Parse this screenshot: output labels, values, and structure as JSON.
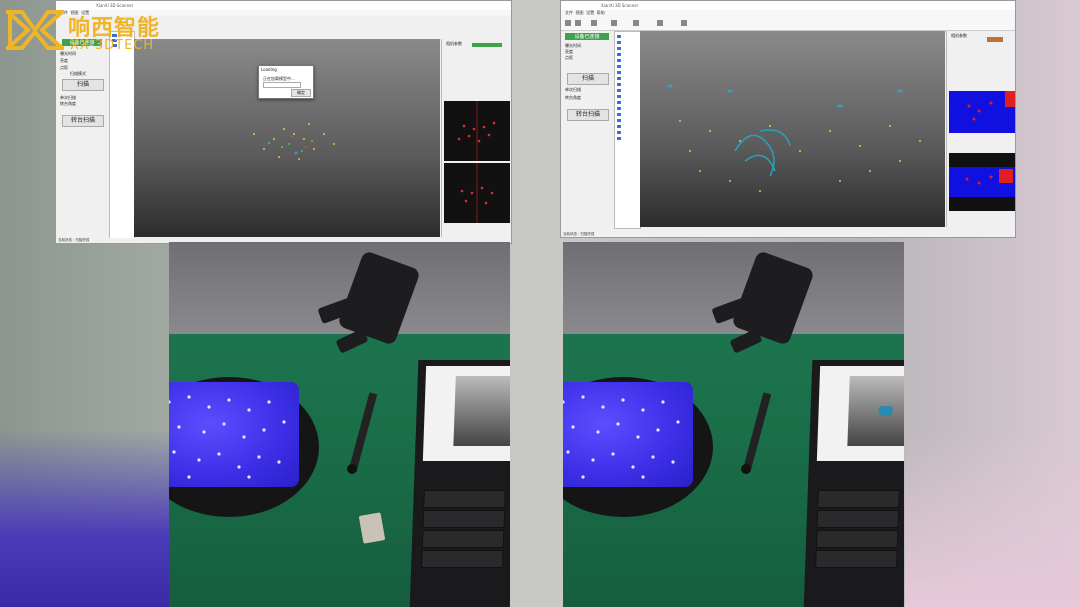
{
  "logo": {
    "icon": "xx-logo-icon",
    "chinese_name": "响西智能",
    "english_name": "XX-3DTECH",
    "color": "#f0b428"
  },
  "left_window": {
    "title": "XianXi 3D Scanner",
    "menu": [
      "文件",
      "视图",
      "设置"
    ],
    "panel": {
      "header_button": "设备已连接",
      "mode_label": "扫描模式",
      "scan_button": "扫描",
      "turntable_button": "转台扫描",
      "fields": [
        "曝光时间",
        "亮度",
        "点距",
        "单次扫描",
        "转台角度"
      ]
    },
    "dialog": {
      "title": "Loading",
      "message": "正在加载模型中...",
      "button": "确定"
    },
    "right_panel_title": "相机参数",
    "status": "当前状态 : 扫描完成"
  },
  "right_window": {
    "title": "XianXi 3D Scanner",
    "menu": [
      "文件",
      "视图",
      "设置",
      "帮助"
    ],
    "panel": {
      "header_button": "设备已连接",
      "scan_button": "扫描",
      "turntable_button": "转台扫描",
      "fields": [
        "曝光时间",
        "亮度",
        "点距",
        "单次扫描",
        "转台角度"
      ]
    },
    "right_panel_title": "相机参数",
    "status": "当前状态 : 扫描完成"
  },
  "photos": {
    "left_caption": "",
    "right_caption": ""
  },
  "colors": {
    "accent_green": "#3ea24a",
    "desk_green": "#1f7a53",
    "turntable_blue": "#3b2ee6"
  }
}
